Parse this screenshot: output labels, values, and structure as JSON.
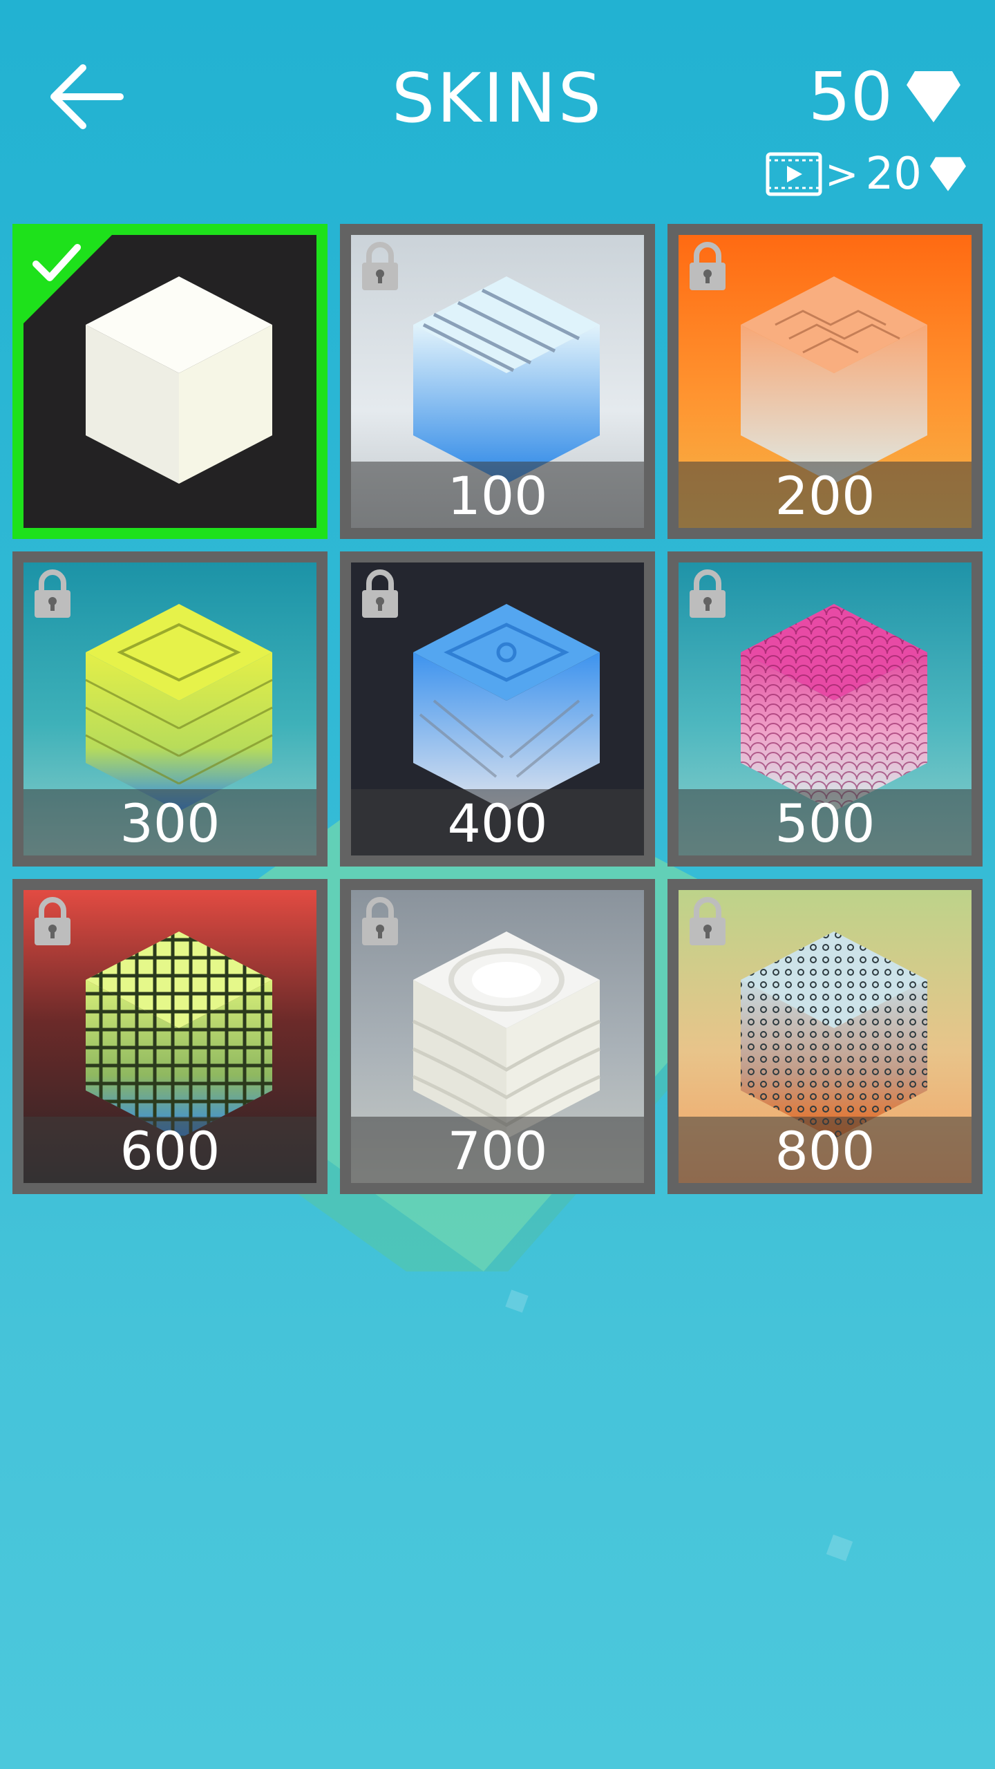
{
  "header": {
    "title": "SKINS",
    "gems": "50",
    "video_reward": "20"
  },
  "colors": {
    "selected_border": "#1ee11b",
    "card_border": "#636363",
    "background": "#2ab5d3"
  },
  "skins": [
    {
      "name": "white",
      "price": "",
      "selected": true,
      "locked": false,
      "bg": "dark"
    },
    {
      "name": "ice-stripes",
      "price": "100",
      "selected": false,
      "locked": true,
      "bg": "light-gray"
    },
    {
      "name": "orange-herringbone",
      "price": "200",
      "selected": false,
      "locked": true,
      "bg": "orange"
    },
    {
      "name": "yellow-greek-key",
      "price": "300",
      "selected": false,
      "locked": true,
      "bg": "teal"
    },
    {
      "name": "blue-tiles",
      "price": "400",
      "selected": false,
      "locked": true,
      "bg": "dark-navy"
    },
    {
      "name": "pink-scales",
      "price": "500",
      "selected": false,
      "locked": true,
      "bg": "teal-light"
    },
    {
      "name": "lime-weave",
      "price": "600",
      "selected": false,
      "locked": true,
      "bg": "red"
    },
    {
      "name": "white-rings",
      "price": "700",
      "selected": false,
      "locked": true,
      "bg": "gray"
    },
    {
      "name": "dotted-sunset",
      "price": "800",
      "selected": false,
      "locked": true,
      "bg": "sunset"
    }
  ]
}
